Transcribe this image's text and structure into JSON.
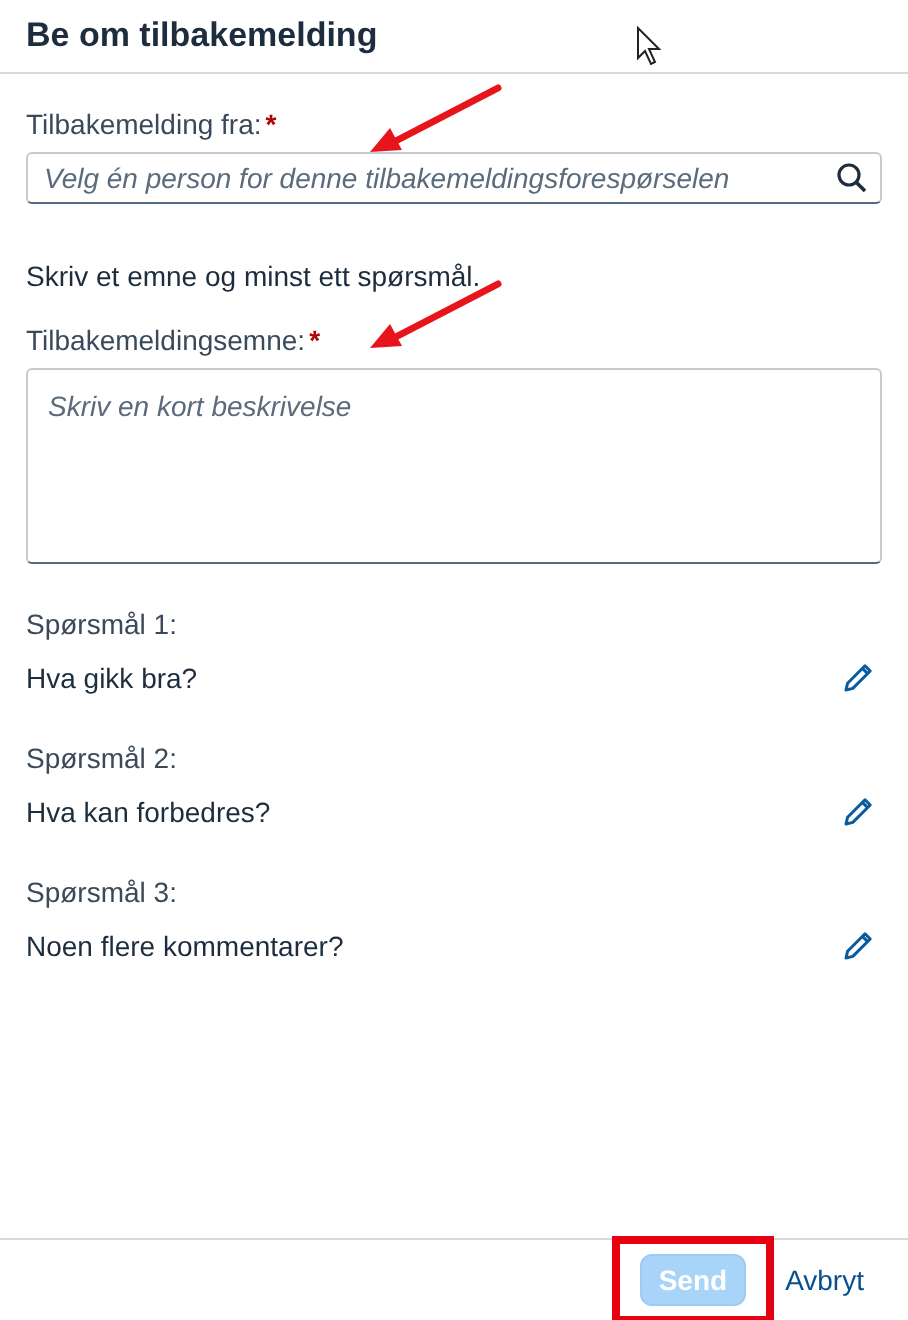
{
  "dialog": {
    "title": "Be om tilbakemelding"
  },
  "from_field": {
    "label": "Tilbakemelding fra:",
    "required": true,
    "required_mark": "*",
    "placeholder": "Velg én person for denne tilbakemeldingsforespørselen"
  },
  "instruction": "Skriv et emne og minst ett spørsmål.",
  "subject_field": {
    "label": "Tilbakemeldingsemne:",
    "required": true,
    "required_mark": "*",
    "placeholder": "Skriv en kort beskrivelse"
  },
  "questions": [
    {
      "label": "Spørsmål 1:",
      "text": "Hva gikk bra?"
    },
    {
      "label": "Spørsmål 2:",
      "text": "Hva kan forbedres?"
    },
    {
      "label": "Spørsmål 3:",
      "text": "Noen flere kommentarer?"
    }
  ],
  "footer": {
    "buttons": [
      {
        "kind": "primary",
        "label": "Send",
        "disabled": true,
        "highlighted": true
      },
      {
        "kind": "link",
        "label": "Avbryt",
        "disabled": false,
        "highlighted": false
      }
    ]
  }
}
